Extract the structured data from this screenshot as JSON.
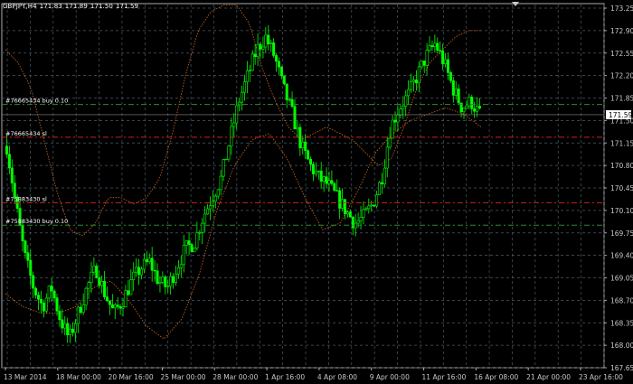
{
  "header": {
    "symbol": "GBPJPY,H4",
    "open": "171.83",
    "high": "171.89",
    "low": "171.50",
    "close": "171.59"
  },
  "colors": {
    "background": "#000000",
    "grid": "#4a5a68",
    "bull_candle": "#00ff00",
    "bear_candle": "#00ff00",
    "bands": "#d2691e",
    "buy_line": "#2e8b2e",
    "sl_line": "#cc2222",
    "axis_text": "#c8c8c8",
    "price_label_bg": "#ffffff"
  },
  "price_axis": {
    "labels": [
      "173.25",
      "172.90",
      "172.55",
      "172.20",
      "171.85",
      "171.50",
      "171.15",
      "170.80",
      "170.45",
      "170.10",
      "169.75",
      "169.40",
      "169.05",
      "168.70",
      "168.35",
      "168.00",
      "167.65"
    ],
    "min": 167.65,
    "max": 173.25,
    "current_price": "171.59"
  },
  "time_axis": {
    "labels": [
      "13 Mar 2014",
      "18 Mar 00:00",
      "20 Mar 16:00",
      "25 Mar 00:00",
      "28 Mar 00:00",
      "1 Apr 16:00",
      "4 Apr 08:00",
      "9 Apr 00:00",
      "11 Apr 16:00",
      "16 Apr 08:00",
      "21 Apr 00:00",
      "23 Apr 16:00"
    ]
  },
  "order_lines": [
    {
      "label": "#76665434 buy 0.10",
      "price": 171.75,
      "kind": "buy"
    },
    {
      "label": "#76665434 sl",
      "price": 171.24,
      "kind": "sl"
    },
    {
      "label": "#75883430 sl",
      "price": 170.22,
      "kind": "sl"
    },
    {
      "label": "#75883430 buy 0.10",
      "price": 169.87,
      "kind": "buy"
    }
  ],
  "chart_data": {
    "type": "candlestick",
    "symbol": "GBPJPY,H4",
    "ylim": [
      167.65,
      173.25
    ],
    "x_labels": [
      "13 Mar 2014",
      "18 Mar 00:00",
      "20 Mar 16:00",
      "25 Mar 00:00",
      "28 Mar 00:00",
      "1 Apr 16:00",
      "4 Apr 08:00",
      "9 Apr 00:00",
      "11 Apr 16:00",
      "16 Apr 08:00",
      "21 Apr 00:00",
      "23 Apr 16:00"
    ],
    "close_path": [
      171.1,
      170.2,
      169.4,
      168.9,
      168.6,
      168.9,
      168.4,
      168.1,
      168.5,
      168.9,
      169.2,
      168.8,
      168.5,
      168.7,
      169.0,
      169.2,
      169.3,
      169.0,
      168.9,
      169.2,
      169.5,
      169.6,
      170.0,
      170.3,
      170.6,
      171.2,
      171.8,
      172.2,
      172.6,
      172.8,
      172.5,
      172.0,
      171.6,
      171.1,
      170.8,
      170.6,
      170.5,
      170.3,
      170.1,
      169.9,
      170.0,
      170.2,
      170.6,
      171.4,
      171.7,
      171.9,
      172.2,
      172.5,
      172.7,
      172.4,
      172.0,
      171.7,
      171.8,
      171.6
    ],
    "upper_band_path": [
      172.6,
      172.4,
      172.0,
      171.2,
      170.4,
      169.8,
      169.7,
      169.9,
      170.3,
      170.3,
      170.2,
      170.3,
      170.6,
      171.3,
      172.2,
      172.9,
      173.2,
      173.3,
      173.3,
      173.0,
      172.3,
      171.8,
      171.4,
      171.2,
      171.3,
      171.4,
      171.3,
      171.2,
      171.0,
      170.8,
      170.9,
      171.4,
      172.0,
      172.4,
      172.6,
      172.8,
      172.9,
      172.9
    ],
    "lower_band_path": [
      168.8,
      168.6,
      168.5,
      168.5,
      168.6,
      168.9,
      169.0,
      168.7,
      168.3,
      168.1,
      168.4,
      169.1,
      170.1,
      170.8,
      171.2,
      171.3,
      170.9,
      170.3,
      169.8,
      169.9,
      170.4,
      171.0,
      171.3,
      171.5,
      171.6,
      171.7,
      171.6,
      171.4
    ],
    "legend": "none",
    "grid": "on"
  }
}
